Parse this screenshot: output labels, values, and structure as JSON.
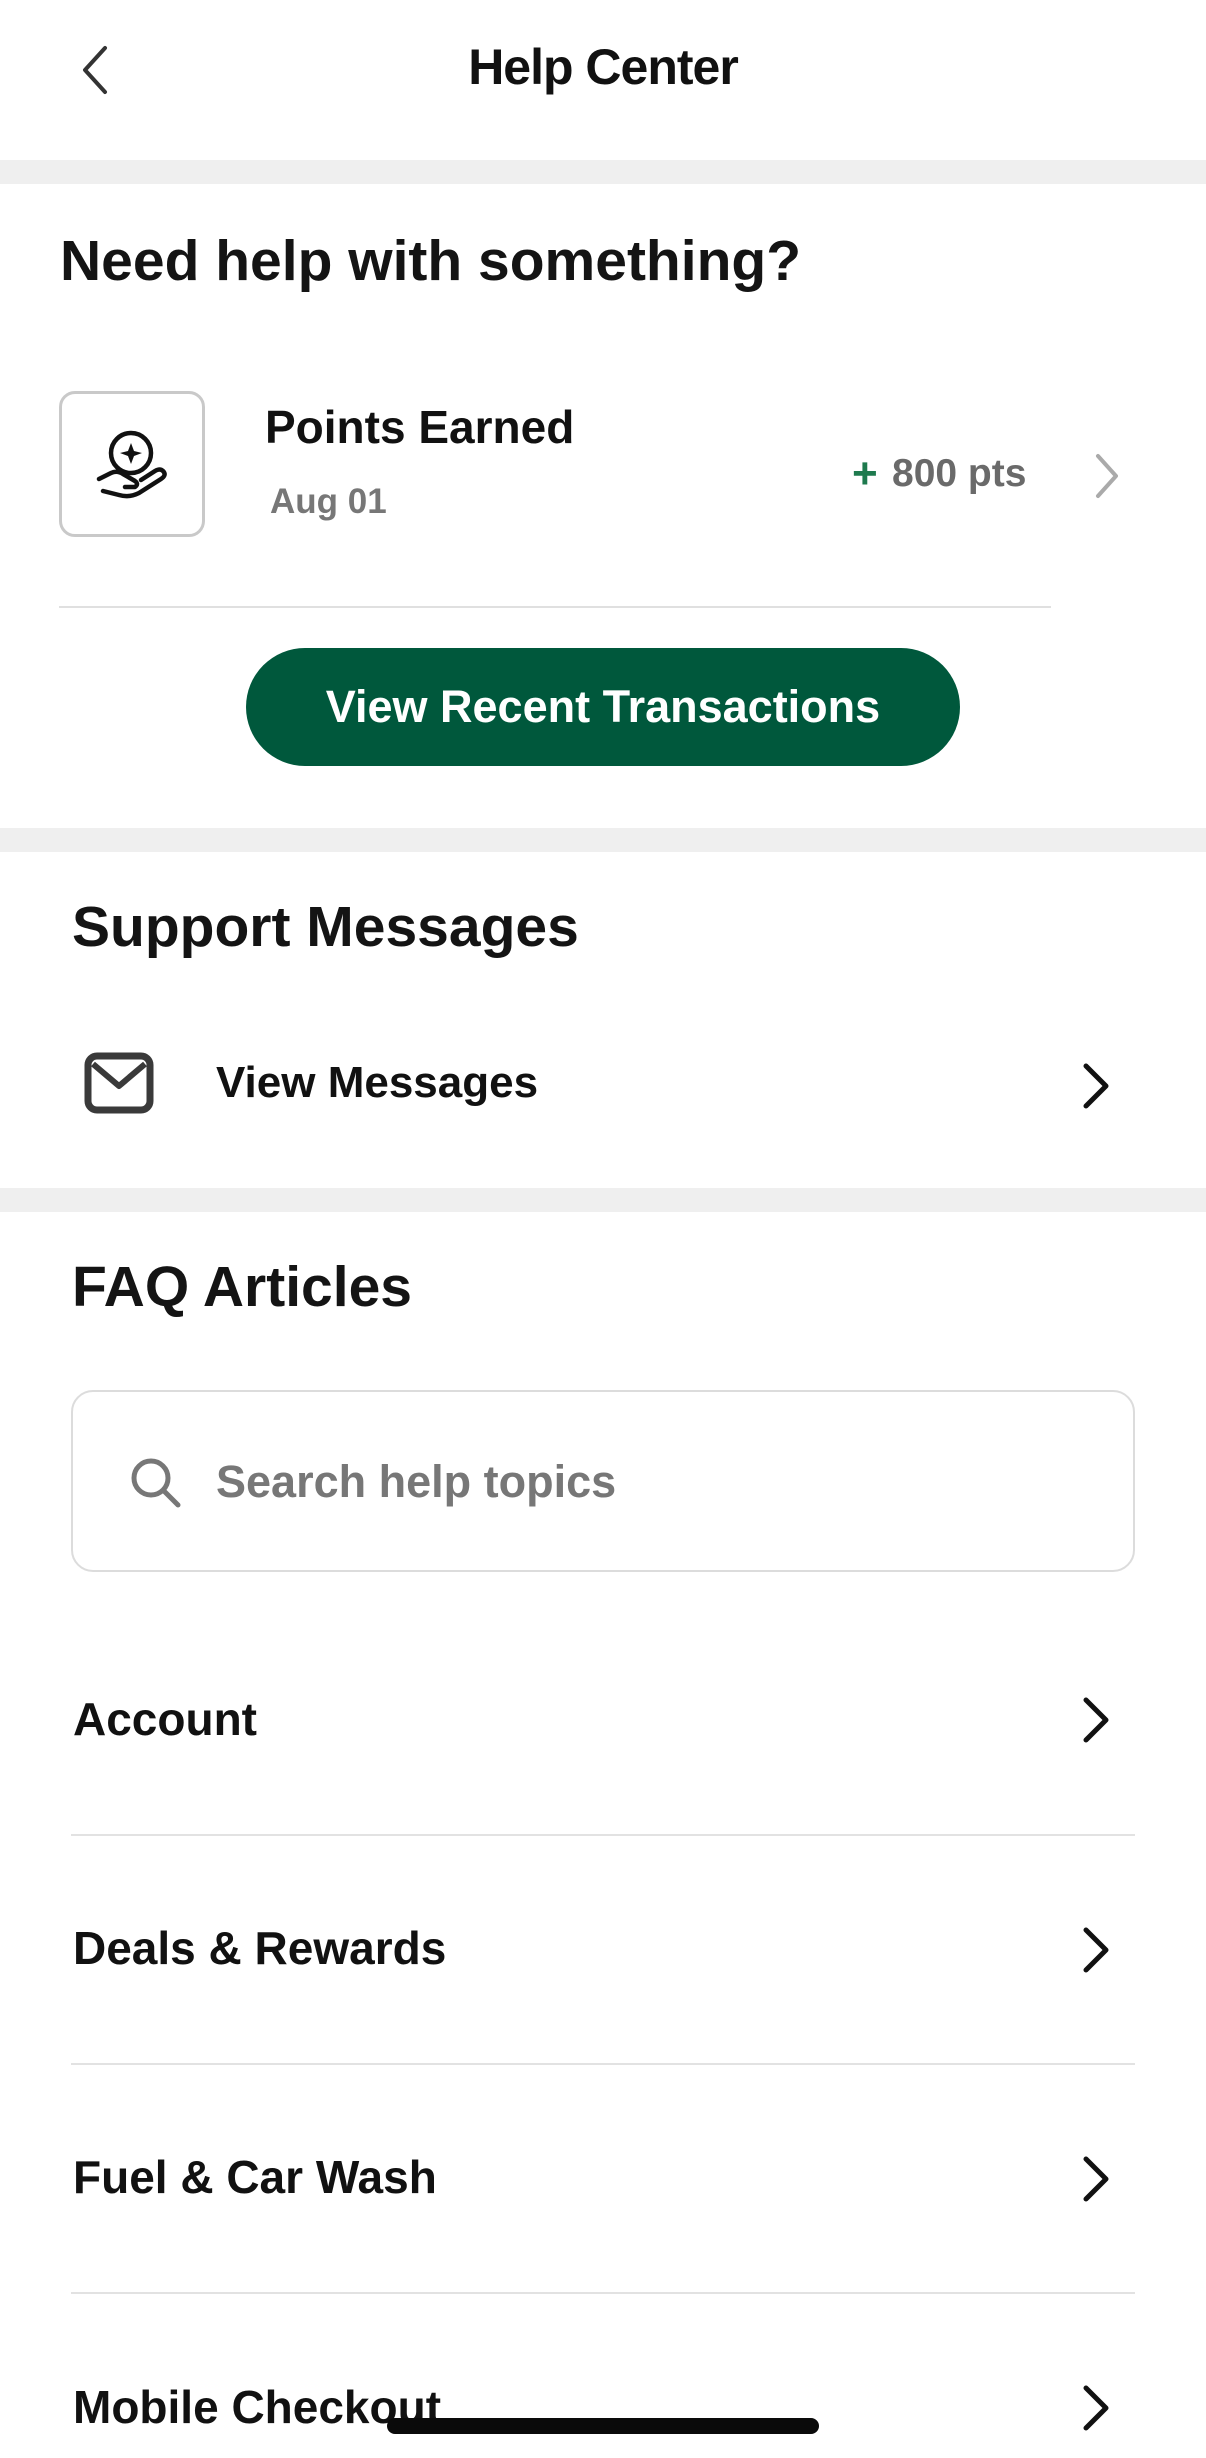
{
  "header": {
    "title": "Help Center"
  },
  "help": {
    "title": "Need help with something?",
    "transaction": {
      "title": "Points Earned",
      "date": "Aug 01",
      "sign": "+",
      "points": "800 pts"
    },
    "cta_label": "View Recent Transactions"
  },
  "support": {
    "title": "Support Messages",
    "view_messages_label": "View Messages"
  },
  "faq": {
    "title": "FAQ Articles",
    "search_placeholder": "Search help topics",
    "items": [
      {
        "label": "Account"
      },
      {
        "label": "Deals & Rewards"
      },
      {
        "label": "Fuel & Car Wash"
      },
      {
        "label": "Mobile Checkout"
      }
    ]
  },
  "colors": {
    "brand_green": "#00583c",
    "points_green": "#1e7a4e",
    "separator": "#efefef"
  },
  "icons": {
    "back": "chevron-left-icon",
    "reward": "reward-star-hand-icon",
    "mail": "envelope-icon",
    "search": "search-icon",
    "row": "chevron-right-icon"
  }
}
